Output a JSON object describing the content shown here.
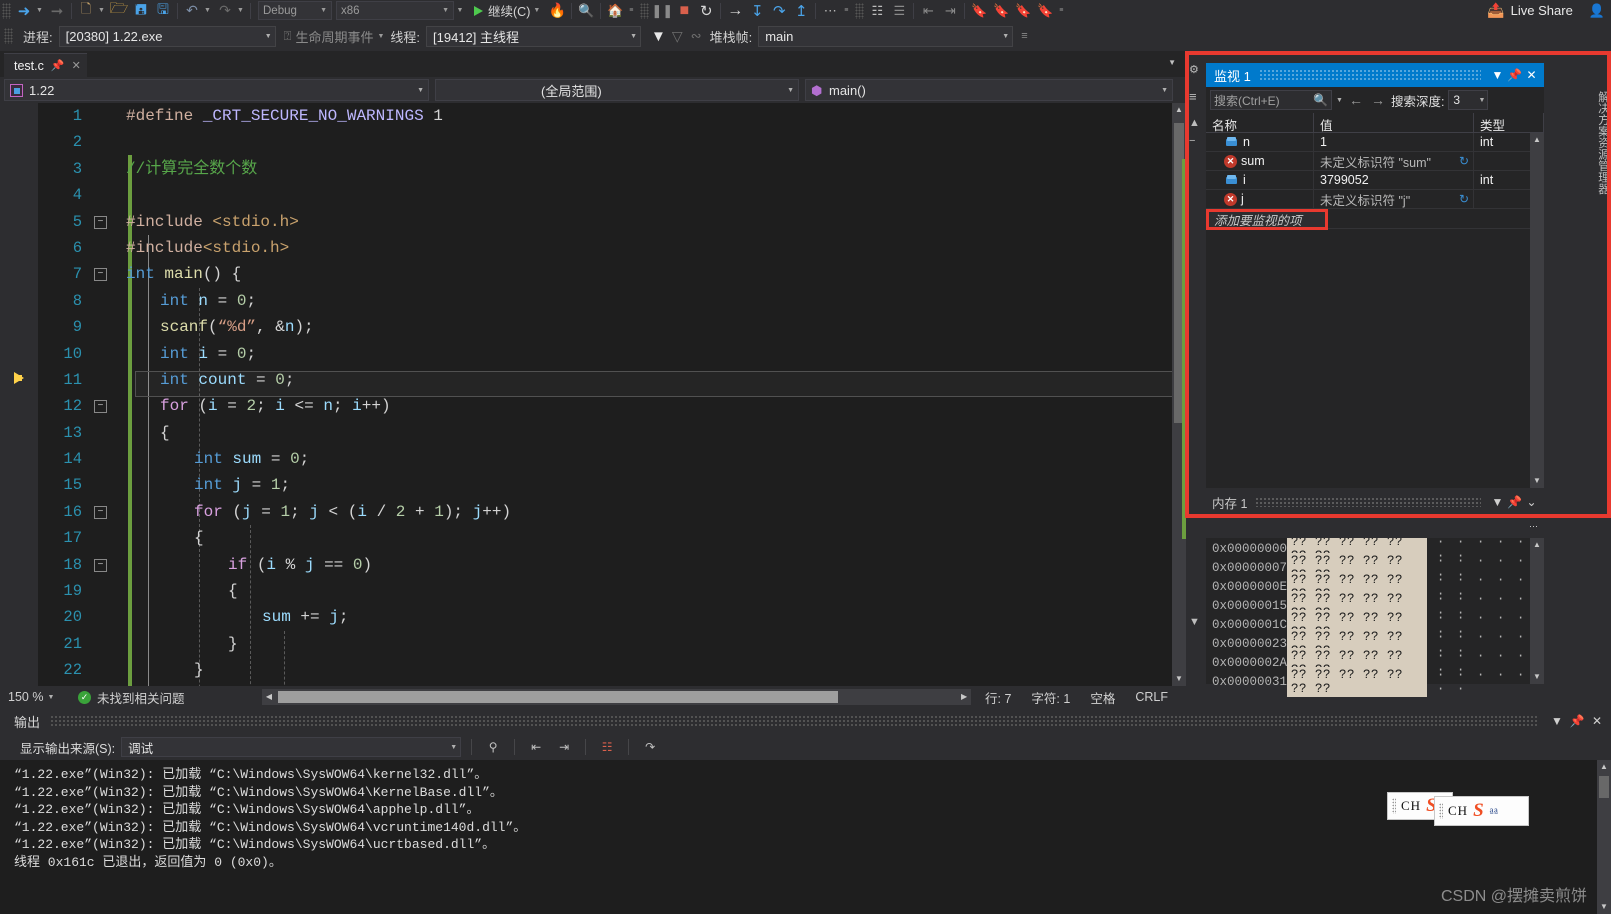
{
  "toolbar": {
    "config_value": "Debug",
    "platform_value": "x86",
    "continue_label": "继续(C)",
    "live_share_label": "Live Share"
  },
  "debugbar": {
    "process_label": "进程:",
    "process_value": "[20380] 1.22.exe",
    "lifecycle_label": "生命周期事件",
    "thread_label": "线程:",
    "thread_value": "[19412] 主线程",
    "stackframe_label": "堆栈帧:",
    "stackframe_value": "main"
  },
  "editor": {
    "tab_label": "test.c",
    "nav_project": "1.22",
    "nav_scope": "(全局范围)",
    "nav_member": "main()",
    "zoom": "150 %",
    "problems": "未找到相关问题",
    "line_label": "行: 7",
    "char_label": "字符: 1",
    "space_label": "空格",
    "eol_label": "CRLF",
    "lines": [
      {
        "n": "1",
        "html": "<span class=\"pp\">#define</span> <span class=\"mac\">_CRT_SECURE_NO_WARNINGS</span> <span class=\"pl\">1</span>",
        "indent": 0
      },
      {
        "n": "2",
        "html": "",
        "indent": 0
      },
      {
        "n": "3",
        "html": "<span class=\"cmt\">//计算完全数个数</span>",
        "indent": 0
      },
      {
        "n": "4",
        "html": "",
        "indent": 0
      },
      {
        "n": "5",
        "html": "<span class=\"pp\">#include</span> <span class=\"inc\">&lt;stdio.h&gt;</span>",
        "indent": 0
      },
      {
        "n": "6",
        "html": "<span class=\"pp\">#include</span><span class=\"inc\">&lt;stdio.h&gt;</span>",
        "indent": 0
      },
      {
        "n": "7",
        "html": "<span class=\"kw\">int</span> <span class=\"fn\">main</span><span class=\"pl\">() {</span>",
        "indent": 0
      },
      {
        "n": "8",
        "html": "<span class=\"kw\">int</span> <span class=\"idn\">n</span> <span class=\"pl\">=</span> <span class=\"num\">0</span><span class=\"pl\">;</span>",
        "indent": 1
      },
      {
        "n": "9",
        "html": "<span class=\"fn\">scanf</span><span class=\"pl\">(</span><span class=\"str\">“%d”</span><span class=\"pl\">, &amp;</span><span class=\"idn\">n</span><span class=\"pl\">);</span>",
        "indent": 1
      },
      {
        "n": "10",
        "html": "<span class=\"kw\">int</span> <span class=\"idn\">i</span> <span class=\"pl\">=</span> <span class=\"num\">0</span><span class=\"pl\">;</span>",
        "indent": 1
      },
      {
        "n": "11",
        "html": "<span class=\"kw\">int</span> <span class=\"idn\">count</span> <span class=\"pl\">=</span> <span class=\"num\">0</span><span class=\"pl\">;</span>",
        "indent": 1
      },
      {
        "n": "12",
        "html": "<span class=\"kwc\">for</span> <span class=\"pl\">(</span><span class=\"idn\">i</span> <span class=\"pl\">=</span> <span class=\"num\">2</span><span class=\"pl\">;</span> <span class=\"idn\">i</span> <span class=\"pl\">&lt;=</span> <span class=\"idn\">n</span><span class=\"pl\">;</span> <span class=\"idn\">i</span><span class=\"pl\">++)</span>",
        "indent": 1
      },
      {
        "n": "13",
        "html": "<span class=\"pl\">{</span>",
        "indent": 1
      },
      {
        "n": "14",
        "html": "<span class=\"kw\">int</span> <span class=\"idn\">sum</span> <span class=\"pl\">=</span> <span class=\"num\">0</span><span class=\"pl\">;</span>",
        "indent": 2
      },
      {
        "n": "15",
        "html": "<span class=\"kw\">int</span> <span class=\"idn\">j</span> <span class=\"pl\">=</span> <span class=\"num\">1</span><span class=\"pl\">;</span>",
        "indent": 2
      },
      {
        "n": "16",
        "html": "<span class=\"kwc\">for</span> <span class=\"pl\">(</span><span class=\"idn\">j</span> <span class=\"pl\">=</span> <span class=\"num\">1</span><span class=\"pl\">;</span> <span class=\"idn\">j</span> <span class=\"pl\">&lt;</span> <span class=\"pl\">(</span><span class=\"idn\">i</span> <span class=\"pl\">/</span> <span class=\"num\">2</span> <span class=\"pl\">+</span> <span class=\"num\">1</span><span class=\"pl\">);</span> <span class=\"idn\">j</span><span class=\"pl\">++)</span>",
        "indent": 2
      },
      {
        "n": "17",
        "html": "<span class=\"pl\">{</span>",
        "indent": 2
      },
      {
        "n": "18",
        "html": "<span class=\"kwc\">if</span> <span class=\"pl\">(</span><span class=\"idn\">i</span> <span class=\"pl\">%</span> <span class=\"idn\">j</span> <span class=\"pl\">==</span> <span class=\"num\">0</span><span class=\"pl\">)</span>",
        "indent": 3
      },
      {
        "n": "19",
        "html": "<span class=\"pl\">{</span>",
        "indent": 3
      },
      {
        "n": "20",
        "html": "<span class=\"idn\">sum</span> <span class=\"pl\">+=</span> <span class=\"idn\">j</span><span class=\"pl\">;</span>",
        "indent": 4
      },
      {
        "n": "21",
        "html": "<span class=\"pl\">}</span>",
        "indent": 3
      },
      {
        "n": "22",
        "html": "<span class=\"pl\">}</span>",
        "indent": 2
      }
    ]
  },
  "watch": {
    "title": "监视 1",
    "search_placeholder": "搜索(Ctrl+E)",
    "depth_label": "搜索深度:",
    "depth_value": "3",
    "columns": [
      "名称",
      "值",
      "类型"
    ],
    "rows": [
      {
        "icon": "variable",
        "name": "n",
        "value": "1",
        "type": "int",
        "error": false
      },
      {
        "icon": "error",
        "name": "sum",
        "value": "未定义标识符 \"sum\"",
        "type": "",
        "error": true
      },
      {
        "icon": "variable",
        "name": "i",
        "value": "3799052",
        "type": "int",
        "error": false
      },
      {
        "icon": "error",
        "name": "j",
        "value": "未定义标识符 \"j\"",
        "type": "",
        "error": true
      }
    ],
    "add_placeholder": "添加要监视的项"
  },
  "memory": {
    "title": "内存 1",
    "rows": [
      {
        "address": "0x00000000",
        "hex": "?? ?? ?? ?? ?? ?? ??",
        "ascii": "· · · · · · ·"
      },
      {
        "address": "0x00000007",
        "hex": "?? ?? ?? ?? ?? ?? ??",
        "ascii": "· · · · · · ·"
      },
      {
        "address": "0x0000000E",
        "hex": "?? ?? ?? ?? ?? ?? ??",
        "ascii": "· · · · · · ·"
      },
      {
        "address": "0x00000015",
        "hex": "?? ?? ?? ?? ?? ?? ??",
        "ascii": "· · · · · · ·"
      },
      {
        "address": "0x0000001C",
        "hex": "?? ?? ?? ?? ?? ?? ??",
        "ascii": "· · · · · · ·"
      },
      {
        "address": "0x00000023",
        "hex": "?? ?? ?? ?? ?? ?? ??",
        "ascii": "· · · · · · ·"
      },
      {
        "address": "0x0000002A",
        "hex": "?? ?? ?? ?? ?? ?? ??",
        "ascii": "· · · · · · ·"
      },
      {
        "address": "0x00000031",
        "hex": "?? ?? ?? ?? ?? ?? ??",
        "ascii": "· · · · · · ·"
      }
    ]
  },
  "sidetab": {
    "label": "解决方案资源管理器"
  },
  "output": {
    "title": "输出",
    "source_label": "显示输出来源(S):",
    "source_value": "调试",
    "lines": [
      "“1.22.exe”(Win32): 已加载 “C:\\Windows\\SysWOW64\\kernel32.dll”。",
      "“1.22.exe”(Win32): 已加载 “C:\\Windows\\SysWOW64\\KernelBase.dll”。",
      "“1.22.exe”(Win32): 已加载 “C:\\Windows\\SysWOW64\\apphelp.dll”。",
      "“1.22.exe”(Win32): 已加载 “C:\\Windows\\SysWOW64\\vcruntime140d.dll”。",
      "“1.22.exe”(Win32): 已加载 “C:\\Windows\\SysWOW64\\ucrtbased.dll”。",
      "线程 0x161c 已退出，返回值为 0 (0x0)。"
    ]
  },
  "ime": {
    "mode": "CH",
    "logo": "S"
  },
  "watermark": "CSDN @摆摊卖煎饼",
  "colors": {
    "accent": "#007acc",
    "highlight_red": "#e8392f",
    "ok_green": "#3aa33a"
  }
}
